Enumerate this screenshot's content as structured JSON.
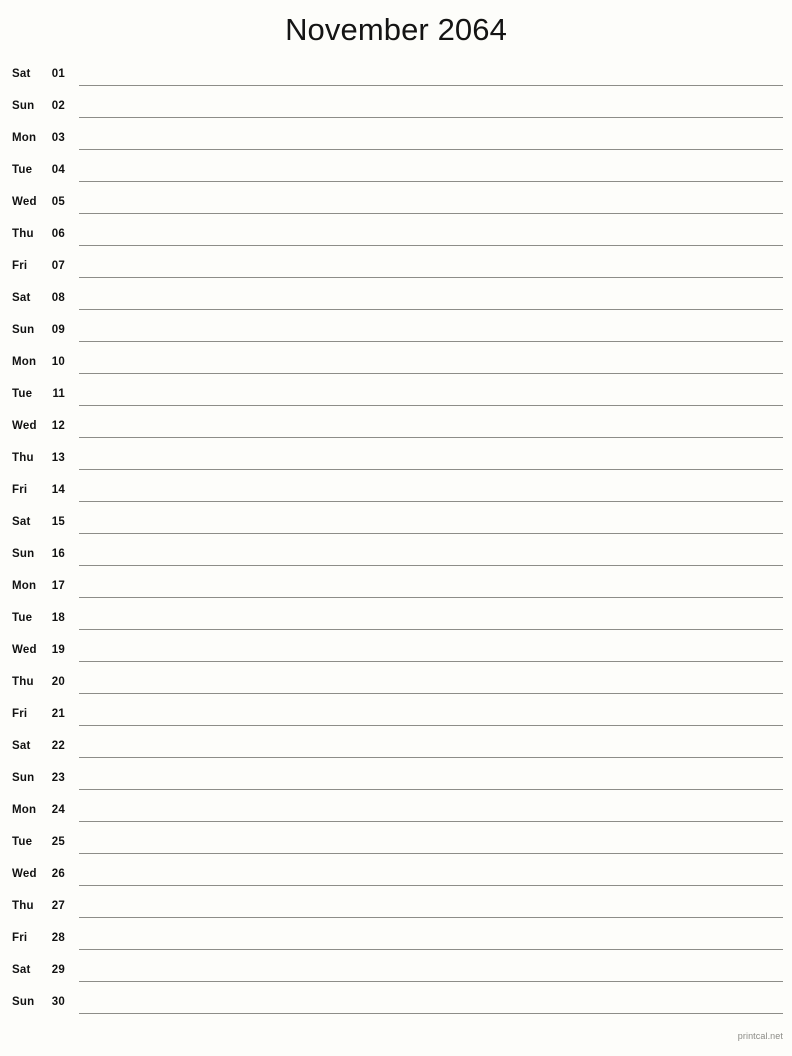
{
  "page": {
    "title": "November 2064",
    "background_color": "#fdfdfa",
    "text_color": "#111111",
    "rule_color": "#8d8d88"
  },
  "calendar": {
    "month_name": "November",
    "year": "2064",
    "first_weekday": "Sat",
    "number_of_days": 30,
    "days": [
      {
        "weekday": "Sat",
        "date": "01"
      },
      {
        "weekday": "Sun",
        "date": "02"
      },
      {
        "weekday": "Mon",
        "date": "03"
      },
      {
        "weekday": "Tue",
        "date": "04"
      },
      {
        "weekday": "Wed",
        "date": "05"
      },
      {
        "weekday": "Thu",
        "date": "06"
      },
      {
        "weekday": "Fri",
        "date": "07"
      },
      {
        "weekday": "Sat",
        "date": "08"
      },
      {
        "weekday": "Sun",
        "date": "09"
      },
      {
        "weekday": "Mon",
        "date": "10"
      },
      {
        "weekday": "Tue",
        "date": "11"
      },
      {
        "weekday": "Wed",
        "date": "12"
      },
      {
        "weekday": "Thu",
        "date": "13"
      },
      {
        "weekday": "Fri",
        "date": "14"
      },
      {
        "weekday": "Sat",
        "date": "15"
      },
      {
        "weekday": "Sun",
        "date": "16"
      },
      {
        "weekday": "Mon",
        "date": "17"
      },
      {
        "weekday": "Tue",
        "date": "18"
      },
      {
        "weekday": "Wed",
        "date": "19"
      },
      {
        "weekday": "Thu",
        "date": "20"
      },
      {
        "weekday": "Fri",
        "date": "21"
      },
      {
        "weekday": "Sat",
        "date": "22"
      },
      {
        "weekday": "Sun",
        "date": "23"
      },
      {
        "weekday": "Mon",
        "date": "24"
      },
      {
        "weekday": "Tue",
        "date": "25"
      },
      {
        "weekday": "Wed",
        "date": "26"
      },
      {
        "weekday": "Thu",
        "date": "27"
      },
      {
        "weekday": "Fri",
        "date": "28"
      },
      {
        "weekday": "Sat",
        "date": "29"
      },
      {
        "weekday": "Sun",
        "date": "30"
      }
    ]
  },
  "footer": {
    "source_label": "printcal.net"
  }
}
